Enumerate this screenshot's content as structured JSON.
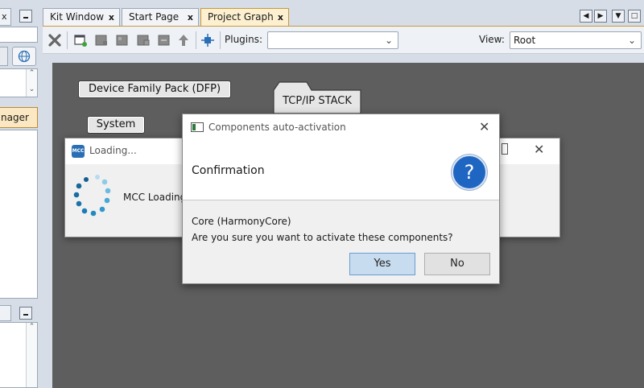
{
  "tabs": [
    {
      "label": "Kit Window",
      "active": false
    },
    {
      "label": "Start Page",
      "active": false
    },
    {
      "label": "Project Graph",
      "active": true
    }
  ],
  "left_panel": {
    "selected_item": "nager"
  },
  "toolbar": {
    "plugins_label": "Plugins:",
    "plugins_value": "",
    "view_label": "View:",
    "view_value": "Root"
  },
  "graph": {
    "nodes": [
      {
        "label": "Device Family Pack (DFP)"
      },
      {
        "label": "System"
      },
      {
        "label": "TCP/IP STACK"
      }
    ]
  },
  "loading_window": {
    "title": "Loading...",
    "message": "MCC Loading",
    "logo_text": "MCC"
  },
  "dialog": {
    "title": "Components auto-activation",
    "header": "Confirmation",
    "component": "Core (HarmonyCore)",
    "question": "Are you sure you want to activate these components?",
    "yes_label": "Yes",
    "no_label": "No",
    "question_icon": "?"
  },
  "colors": {
    "canvas": "#5e5e5e",
    "active_tab": "#fdf0d0",
    "primary_button": "#c7dcef",
    "question_icon": "#1f66c2"
  }
}
